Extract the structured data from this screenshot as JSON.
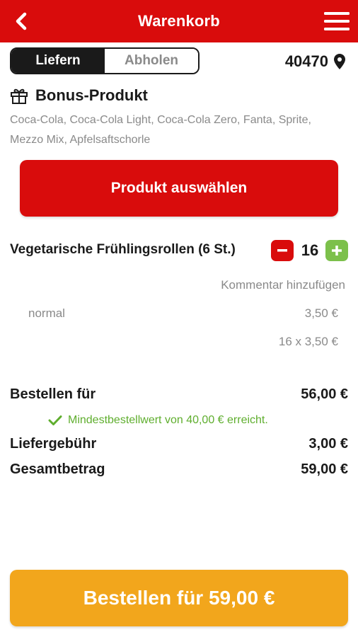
{
  "header": {
    "title": "Warenkorb",
    "back_icon": "chevron-left-icon",
    "menu_icon": "hamburger-menu-icon"
  },
  "delivery_mode": {
    "options": [
      "Liefern",
      "Abholen"
    ],
    "selected": "Liefern"
  },
  "location": {
    "zip": "40470",
    "icon": "map-pin-icon"
  },
  "bonus": {
    "icon": "gift-icon",
    "title": "Bonus-Produkt",
    "description": "Coca-Cola, Coca-Cola Light, Coca-Cola Zero, Fanta, Sprite, Mezzo Mix, Apfelsaftschorle",
    "button_label": "Produkt auswählen"
  },
  "cart_item": {
    "name": "Vegetarische Frühlingsrollen (6 St.)",
    "quantity": "16",
    "comment_label": "Kommentar hinzufügen",
    "variant": "normal",
    "unit_price": "3,50 €",
    "line_total": "16 x 3,50 €"
  },
  "summary": {
    "subtotal_label": "Bestellen für",
    "subtotal_value": "56,00 €",
    "min_order_message": "Mindestbestellwert von 40,00 € erreicht.",
    "delivery_fee_label": "Liefergebühr",
    "delivery_fee_value": "3,00 €",
    "total_label": "Gesamtbetrag",
    "total_value": "59,00 €"
  },
  "checkout": {
    "button_label": "Bestellen für 59,00 €"
  },
  "colors": {
    "brand_red": "#d90c0c",
    "success_green": "#5fae2e",
    "plus_green": "#7cc04b",
    "order_orange": "#f2a61c"
  }
}
